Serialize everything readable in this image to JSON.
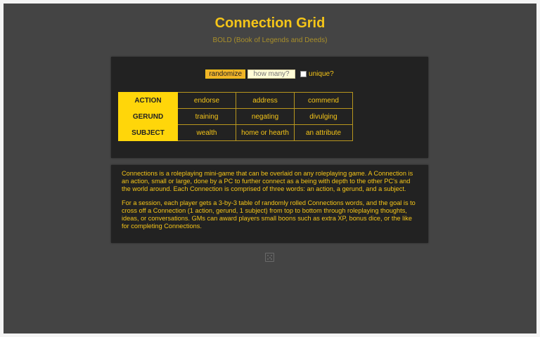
{
  "header": {
    "title": "Connection Grid",
    "subtitle": "BOLD (Book of Legends and Deeds)"
  },
  "controls": {
    "randomize_label": "randomize",
    "howmany_placeholder": "how many?",
    "unique_label": "unique?",
    "unique_checked": false
  },
  "grid": {
    "rows": [
      {
        "label": "ACTION",
        "cells": [
          "endorse",
          "address",
          "commend"
        ]
      },
      {
        "label": "GERUND",
        "cells": [
          "training",
          "negating",
          "divulging"
        ]
      },
      {
        "label": "SUBJECT",
        "cells": [
          "wealth",
          "home or hearth",
          "an attribute"
        ]
      }
    ]
  },
  "info": {
    "paragraph1": "Connections is a roleplaying mini-game that can be overlaid on any roleplaying game. A Connection is an action, small or large, done by a PC to further connect as a being with depth to the other PC's and the world around. Each Connection is comprised of three words: an action, a gerund, and a subject.",
    "paragraph2": "For a session, each player gets a 3-by-3 table of randomly rolled Connections words, and the goal is to cross off a Connection (1 action, gerund, 1 subject) from top to bottom through roleplaying thoughts, ideas, or conversations. GMs can award players small boons such as extra XP, bonus dice, or the like for completing Connections."
  },
  "icons": {
    "dice": "dice-five-icon"
  },
  "colors": {
    "accent": "#f5c518",
    "background": "#444444",
    "panel": "#222222"
  }
}
